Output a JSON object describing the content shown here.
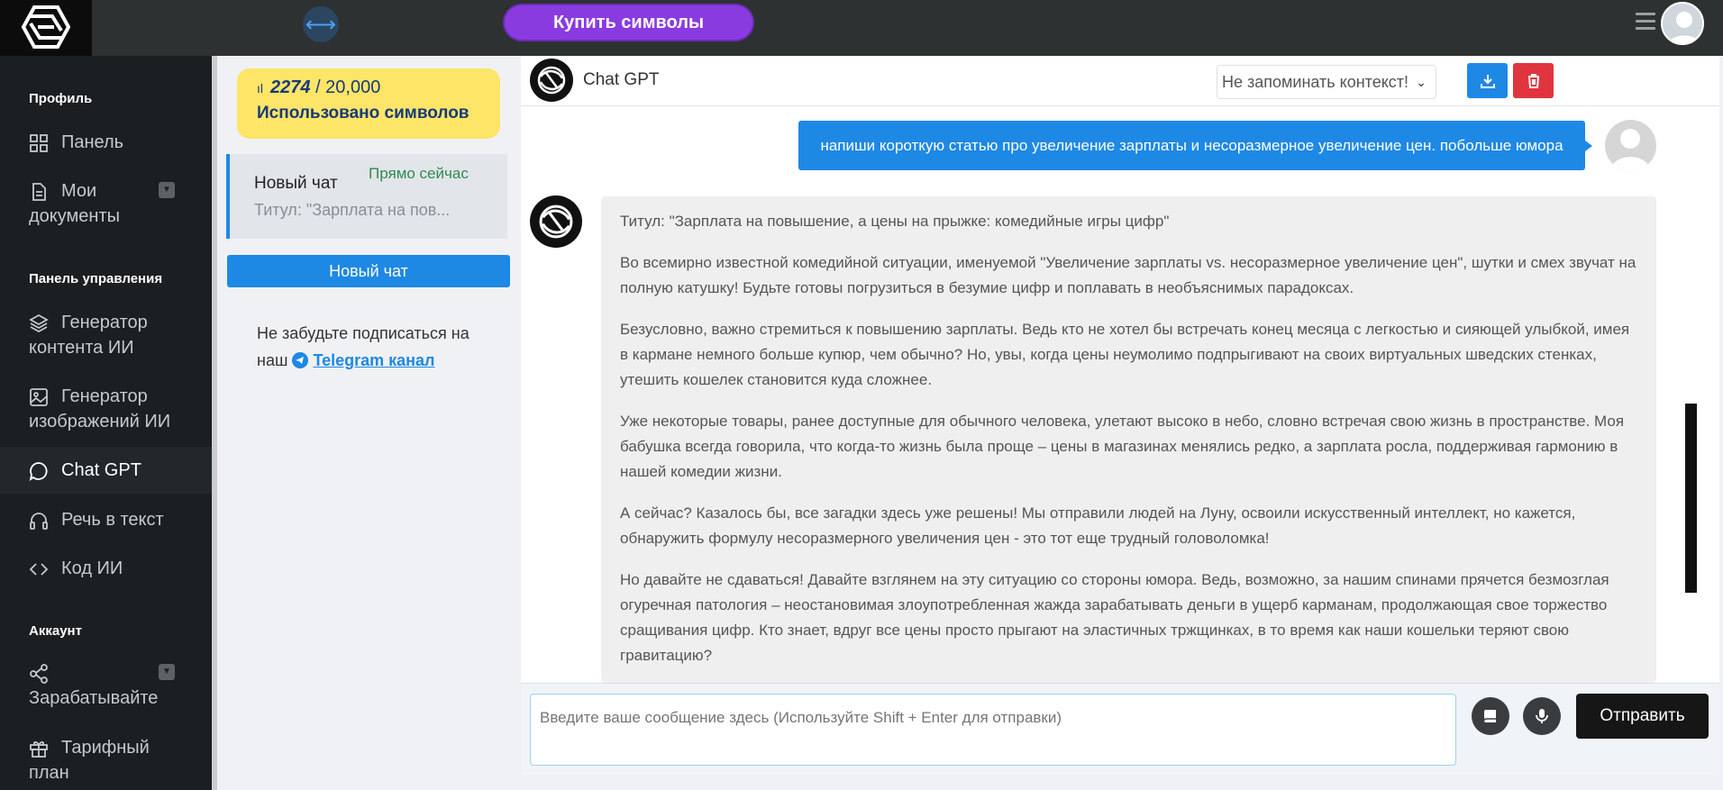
{
  "topbar": {
    "buy_label": "Купить символы"
  },
  "sidebar": {
    "section_profile": "Профиль",
    "panel": "Панель",
    "my_docs_1": "Мои",
    "my_docs_2": "документы",
    "section_control": "Панель управления",
    "content_gen_1": "Генератор",
    "content_gen_2": "контента ИИ",
    "image_gen_1": "Генератор",
    "image_gen_2": "изображений ИИ",
    "chat_gpt": "Chat GPT",
    "speech": "Речь в текст",
    "code": "Код ИИ",
    "section_account": "Аккаунт",
    "earn": "Зарабатывайте",
    "tariff_1": "Тарифный",
    "tariff_2": "план"
  },
  "usage": {
    "used": "2274",
    "total": "/ 20,000",
    "label": "Использовано символов"
  },
  "chat_list": {
    "items": [
      {
        "title": "Новый чат",
        "time": "Прямо сейчас",
        "preview": "Титул: \"Зарплата на пов..."
      }
    ],
    "new_chat_label": "Новый чат"
  },
  "telegram_note": {
    "text": "Не забудьте подписаться на наш",
    "link": "Telegram канал"
  },
  "chat": {
    "title": "Chat GPT",
    "context_select": "Не запоминать контекст!",
    "user_message": "напиши короткую статью про увеличение зарплаты и несоразмерное увеличение цен. побольше юмора",
    "bot_paragraphs": [
      "Титул: \"Зарплата на повышение, а цены на прыжке: комедийные игры цифр\"",
      "Во всемирно известной комедийной ситуации, именуемой \"Увеличение зарплаты vs. несоразмерное увеличение цен\", шутки и смех звучат на полную катушку! Будьте готовы погрузиться в безумие цифр и поплавать в необъяснимых парадоксах.",
      "Безусловно, важно стремиться к повышению зарплаты. Ведь кто не хотел бы встречать конец месяца с легкостью и сияющей улыбкой, имея в кармане немного больше купюр, чем обычно? Но, увы, когда цены неумолимо подпрыгивают на своих виртуальных шведских стенках, утешить кошелек становится куда сложнее.",
      "Уже некоторые товары, ранее доступные для обычного человека, улетают высоко в небо, словно встречая свою жизнь в пространстве. Моя бабушка всегда говорила, что когда-то жизнь была проще – цены в магазинах менялись редко, а зарплата росла, поддерживая гармонию в нашей комедии жизни.",
      "А сейчас? Казалось бы, все загадки здесь уже решены! Мы отправили людей на Луну, освоили искусственный интеллект, но кажется, обнаружить формулу несоразмерного увеличения цен - это тот еще трудный головоломка!",
      "Но давайте не сдаваться! Давайте взглянем на эту ситуацию со стороны юмора. Ведь, возможно, за нашим спинами прячется безмозглая огуречная патология – неостановимая злоупотребленная жажда зарабатывать деньги в ущерб карманам, продолжающая свое торжество сращивания цифр. Кто знает, вдруг все цены просто прыгают на эластичных тржщинках, в то время как наши кошельки теряют свою гравитацию?"
    ],
    "input_placeholder": "Введите ваше сообщение здесь (Используйте Shift + Enter для отправки)",
    "send_label": "Отправить"
  },
  "colors": {
    "accent": "#1e88e5",
    "danger": "#e0353f",
    "purple": "#8a3be0",
    "usage_bg": "#fde568",
    "sidebar_bg": "#1b1f22"
  }
}
